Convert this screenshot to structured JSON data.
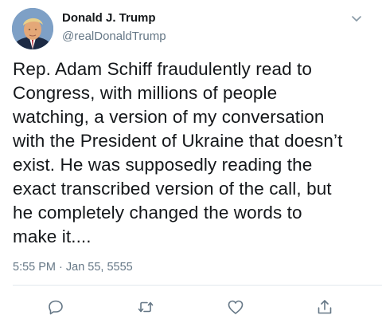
{
  "tweet": {
    "display_name": "Donald J. Trump",
    "handle": "@realDonaldTrump",
    "text": "Rep. Adam Schiff fraudulently read to\nCongress, with millions of people\nwatching, a version of my conversation\nwith the President of Ukraine that doesn’t\nexist. He was supposedly reading the\nexact transcribed version of the call, but\nhe completely changed the words to\nmake it....",
    "timestamp": "5:55 PM · Jan 55, 5555"
  },
  "actions": [
    {
      "name": "reply-icon"
    },
    {
      "name": "retweet-icon"
    },
    {
      "name": "like-icon"
    },
    {
      "name": "share-icon"
    }
  ],
  "colors": {
    "text_primary": "#14171a",
    "text_secondary": "#657786",
    "icon": "#657786",
    "divider": "#e1e8ed"
  }
}
